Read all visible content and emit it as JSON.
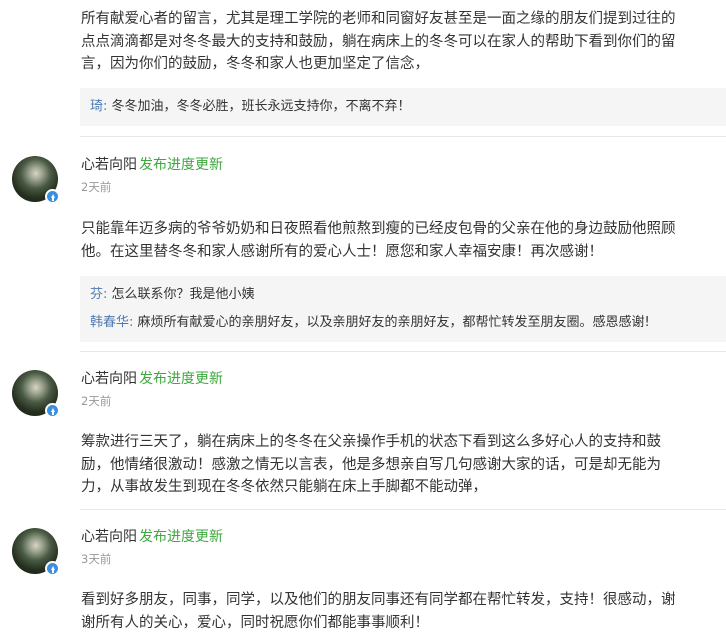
{
  "intro": {
    "lines": [
      "所有献爱心者的留言，尤其是理工学院的老师和同窗好友甚至是一面之缘的朋友们提到过往的",
      "点点滴滴都是对冬冬最大的支持和鼓励，躺在病床上的冬冬可以在家人的帮助下看到你们的留",
      "言，因为你们的鼓励，冬冬和家人也更加坚定了信念，"
    ],
    "replies": [
      {
        "name": "琦:",
        "text": " 冬冬加油，冬冬必胜，班长永远支持你，不离不弃！"
      }
    ]
  },
  "posts": [
    {
      "author": "心若向阳",
      "action": "发布进度更新",
      "time": "2天前",
      "lines": [
        "只能靠年迈多病的爷爷奶奶和日夜照看他煎熬到瘦的已经皮包骨的父亲在他的身边鼓励他照顾",
        "他。在这里替冬冬和家人感谢所有的爱心人士！愿您和家人幸福安康！再次感谢！"
      ],
      "replies": [
        {
          "name": "芬:",
          "text": " 怎么联系你？我是他小姨"
        },
        {
          "name": "韩春华:",
          "text": " 麻烦所有献爱心的亲朋好友，以及亲朋好友的亲朋好友，都帮忙转发至朋友圈。感恩感谢!"
        }
      ]
    },
    {
      "author": "心若向阳",
      "action": "发布进度更新",
      "time": "2天前",
      "lines": [
        "筹款进行三天了，躺在病床上的冬冬在父亲操作手机的状态下看到这么多好心人的支持和鼓",
        "励，他情绪很激动！感激之情无以言表，他是多想亲自写几句感谢大家的话，可是却无能为",
        "力，从事故发生到现在冬冬依然只能躺在床上手脚都不能动弹，"
      ]
    },
    {
      "author": "心若向阳",
      "action": "发布进度更新",
      "time": "3天前",
      "lines": [
        "看到好多朋友，同事，同学，以及他们的朋友同事还有同学都在帮忙转发，支持！很感动，谢",
        "谢所有人的关心，爱心，同时祝愿你们都能事事顺利！"
      ]
    }
  ]
}
